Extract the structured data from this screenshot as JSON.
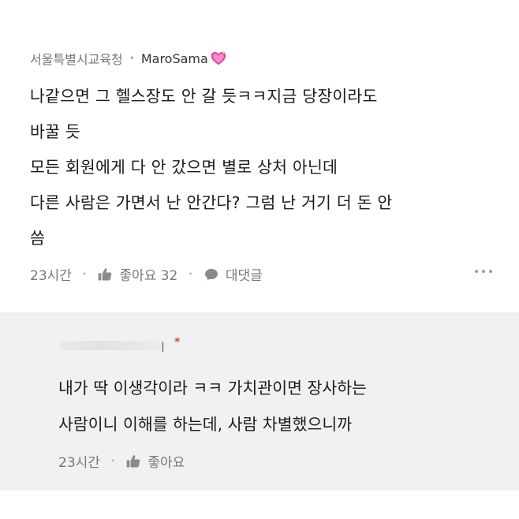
{
  "comment": {
    "affiliation": "서울특별시교육청",
    "separator": "•",
    "username": "MaroSama",
    "badge_icon": "sparkling-heart-icon",
    "lines": [
      "나같으면 그 헬스장도 안 갈 듯ㅋㅋ지금 당장이라도",
      "바꿀 듯",
      "모든 회원에게 다 안 갔으면 별로 상처 아닌데",
      "다른 사람은 가면서 난 안간다? 그럼 난 거기 더 돈 안",
      "씀"
    ],
    "time": "23시간",
    "like_label": "좋아요 32",
    "reply_label": "대댓글",
    "more_icon": "more-dots-icon"
  },
  "reply": {
    "author_fragment": "ㅣ",
    "author_marker": "*",
    "lines": [
      "내가 딱 이생각이라 ㅋㅋ 가치관이면  장사하는",
      "사람이니 이해를 하는데, 사람 차별했으니까"
    ],
    "time": "23시간",
    "like_label": "좋아요"
  },
  "colors": {
    "reply_background": "#f1f1f3",
    "meta_text": "#777777",
    "heart": "#e93fa8",
    "marker": "#e0433b"
  }
}
